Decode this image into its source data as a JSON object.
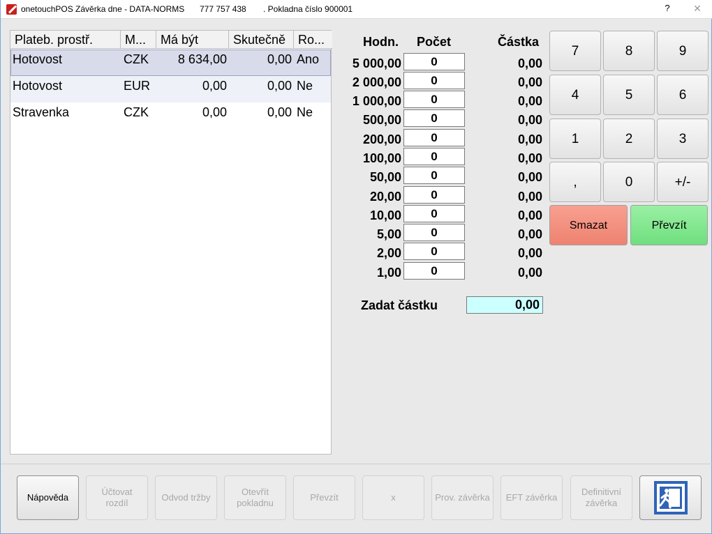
{
  "titlebar": {
    "app_title": "onetouchPOS Závěrka dne - DATA-NORMS",
    "phone": "777 757 438",
    "register": ". Pokladna číslo 900001",
    "help": "?",
    "close": "✕"
  },
  "grid": {
    "columns": [
      "Plateb. prostř.",
      "M...",
      "Má být",
      "Skutečně",
      "Ro..."
    ],
    "rows": [
      {
        "method": "Hotovost",
        "currency": "CZK",
        "expected": "8 634,00",
        "actual": "0,00",
        "diff": "Ano"
      },
      {
        "method": "Hotovost",
        "currency": "EUR",
        "expected": "0,00",
        "actual": "0,00",
        "diff": "Ne"
      },
      {
        "method": "Stravenka",
        "currency": "CZK",
        "expected": "0,00",
        "actual": "0,00",
        "diff": "Ne"
      }
    ]
  },
  "denominations": {
    "headers": {
      "value": "Hodn.",
      "count": "Počet",
      "amount": "Částka"
    },
    "rows": [
      {
        "value": "5 000,00",
        "count": "0",
        "amount": "0,00"
      },
      {
        "value": "2 000,00",
        "count": "0",
        "amount": "0,00"
      },
      {
        "value": "1 000,00",
        "count": "0",
        "amount": "0,00"
      },
      {
        "value": "500,00",
        "count": "0",
        "amount": "0,00"
      },
      {
        "value": "200,00",
        "count": "0",
        "amount": "0,00"
      },
      {
        "value": "100,00",
        "count": "0",
        "amount": "0,00"
      },
      {
        "value": "50,00",
        "count": "0",
        "amount": "0,00"
      },
      {
        "value": "20,00",
        "count": "0",
        "amount": "0,00"
      },
      {
        "value": "10,00",
        "count": "0",
        "amount": "0,00"
      },
      {
        "value": "5,00",
        "count": "0",
        "amount": "0,00"
      },
      {
        "value": "2,00",
        "count": "0",
        "amount": "0,00"
      },
      {
        "value": "1,00",
        "count": "0",
        "amount": "0,00"
      }
    ],
    "enter_label": "Zadat částku",
    "enter_value": "0,00"
  },
  "keypad": {
    "keys": [
      "7",
      "8",
      "9",
      "4",
      "5",
      "6",
      "1",
      "2",
      "3",
      ",",
      "0",
      "+/-"
    ],
    "clear_label": "Smazat",
    "take_label": "Převzít",
    "clear_color": "#f09080",
    "take_color": "#80e890"
  },
  "bottom": {
    "buttons": [
      {
        "label": "Nápověda",
        "enabled": true
      },
      {
        "label": "Účtovat rozdíl",
        "enabled": false
      },
      {
        "label": "Odvod tržby",
        "enabled": false
      },
      {
        "label": "Otevřít pokladnu",
        "enabled": false
      },
      {
        "label": "Převzít",
        "enabled": false
      },
      {
        "label": "x",
        "enabled": false
      },
      {
        "label": "Prov. závěrka",
        "enabled": false
      },
      {
        "label": "EFT závěrka",
        "enabled": false
      },
      {
        "label": "Definitivní závěrka",
        "enabled": false
      }
    ],
    "exit_icon": "exit-door-icon"
  },
  "colors": {
    "selected_row": "#d8dcea",
    "alt_row": "#eef1f8",
    "enter_field_bg": "#ccffff",
    "exit_icon_blue": "#2f63b8"
  }
}
